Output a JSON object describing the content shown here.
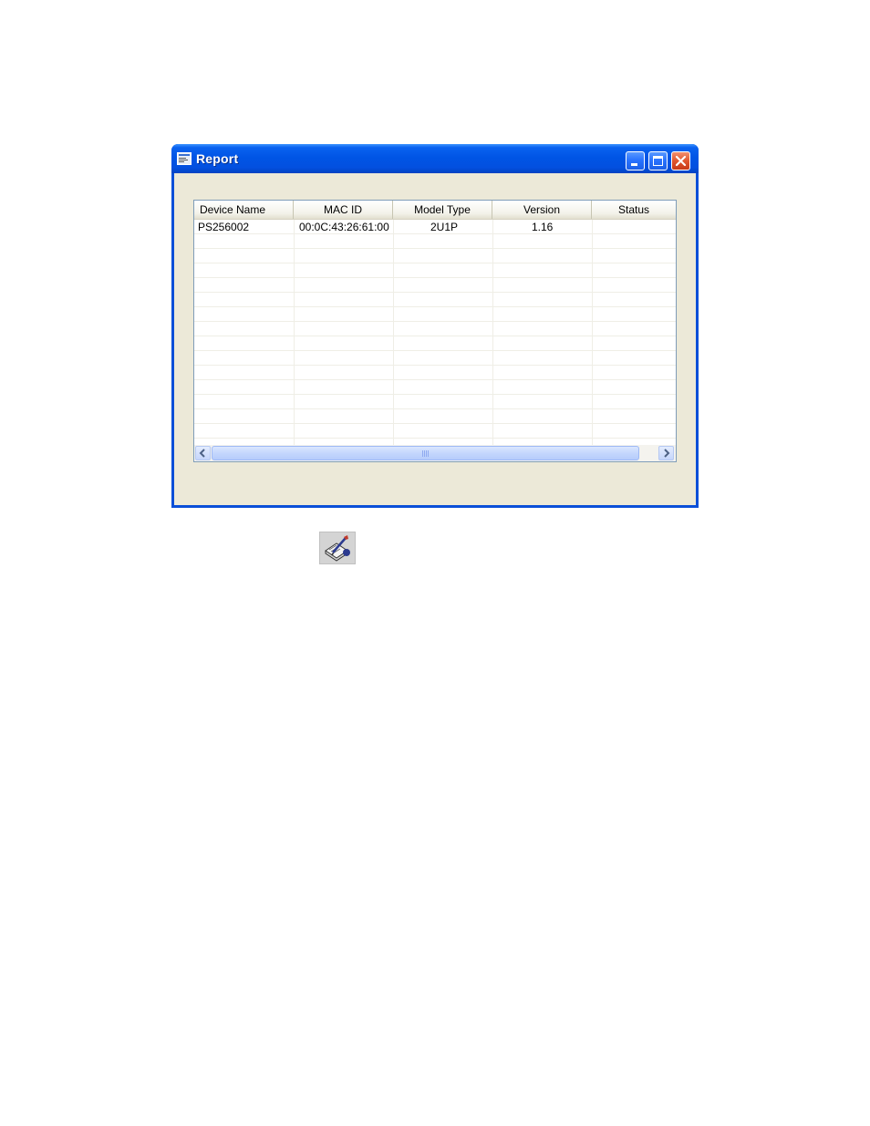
{
  "window": {
    "title": "Report",
    "icons": {
      "app": "report-window-icon",
      "minimize": "minimize-icon",
      "maximize": "maximize-icon",
      "close": "close-icon"
    }
  },
  "table": {
    "columns": [
      "Device Name",
      "MAC ID",
      "Model Type",
      "Version",
      "Status"
    ],
    "rows": [
      [
        "PS256002",
        "00:0C:43:26:61:00",
        "2U1P",
        "1.16",
        ""
      ]
    ]
  },
  "scrollbar": {
    "left_icon": "chevron-left-icon",
    "right_icon": "chevron-right-icon"
  },
  "toolbar_icon": "report-tool-icon",
  "colors": {
    "titlebar": "#0055e5",
    "close_button": "#e0562e",
    "client_bg": "#ece9d8"
  }
}
